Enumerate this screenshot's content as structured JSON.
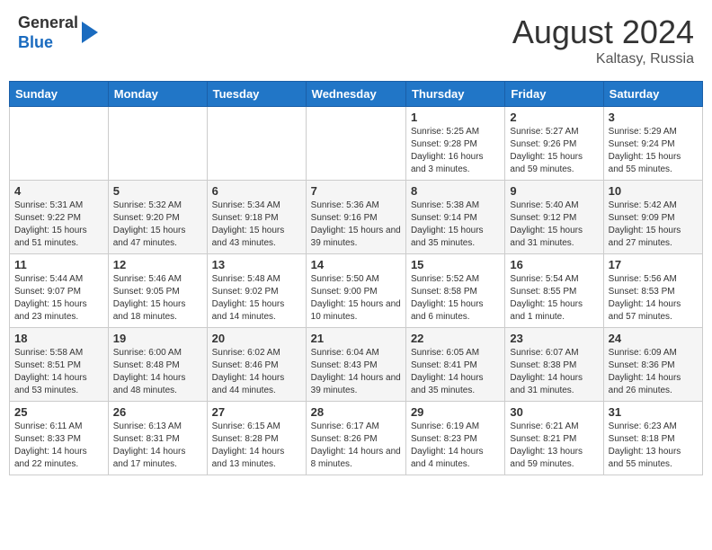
{
  "header": {
    "logo_line1": "General",
    "logo_line2": "Blue",
    "month_year": "August 2024",
    "location": "Kaltasy, Russia"
  },
  "days_of_week": [
    "Sunday",
    "Monday",
    "Tuesday",
    "Wednesday",
    "Thursday",
    "Friday",
    "Saturday"
  ],
  "weeks": [
    [
      {
        "day": "",
        "sunrise": "",
        "sunset": "",
        "daylight": ""
      },
      {
        "day": "",
        "sunrise": "",
        "sunset": "",
        "daylight": ""
      },
      {
        "day": "",
        "sunrise": "",
        "sunset": "",
        "daylight": ""
      },
      {
        "day": "",
        "sunrise": "",
        "sunset": "",
        "daylight": ""
      },
      {
        "day": "1",
        "sunrise": "Sunrise: 5:25 AM",
        "sunset": "Sunset: 9:28 PM",
        "daylight": "Daylight: 16 hours and 3 minutes."
      },
      {
        "day": "2",
        "sunrise": "Sunrise: 5:27 AM",
        "sunset": "Sunset: 9:26 PM",
        "daylight": "Daylight: 15 hours and 59 minutes."
      },
      {
        "day": "3",
        "sunrise": "Sunrise: 5:29 AM",
        "sunset": "Sunset: 9:24 PM",
        "daylight": "Daylight: 15 hours and 55 minutes."
      }
    ],
    [
      {
        "day": "4",
        "sunrise": "Sunrise: 5:31 AM",
        "sunset": "Sunset: 9:22 PM",
        "daylight": "Daylight: 15 hours and 51 minutes."
      },
      {
        "day": "5",
        "sunrise": "Sunrise: 5:32 AM",
        "sunset": "Sunset: 9:20 PM",
        "daylight": "Daylight: 15 hours and 47 minutes."
      },
      {
        "day": "6",
        "sunrise": "Sunrise: 5:34 AM",
        "sunset": "Sunset: 9:18 PM",
        "daylight": "Daylight: 15 hours and 43 minutes."
      },
      {
        "day": "7",
        "sunrise": "Sunrise: 5:36 AM",
        "sunset": "Sunset: 9:16 PM",
        "daylight": "Daylight: 15 hours and 39 minutes."
      },
      {
        "day": "8",
        "sunrise": "Sunrise: 5:38 AM",
        "sunset": "Sunset: 9:14 PM",
        "daylight": "Daylight: 15 hours and 35 minutes."
      },
      {
        "day": "9",
        "sunrise": "Sunrise: 5:40 AM",
        "sunset": "Sunset: 9:12 PM",
        "daylight": "Daylight: 15 hours and 31 minutes."
      },
      {
        "day": "10",
        "sunrise": "Sunrise: 5:42 AM",
        "sunset": "Sunset: 9:09 PM",
        "daylight": "Daylight: 15 hours and 27 minutes."
      }
    ],
    [
      {
        "day": "11",
        "sunrise": "Sunrise: 5:44 AM",
        "sunset": "Sunset: 9:07 PM",
        "daylight": "Daylight: 15 hours and 23 minutes."
      },
      {
        "day": "12",
        "sunrise": "Sunrise: 5:46 AM",
        "sunset": "Sunset: 9:05 PM",
        "daylight": "Daylight: 15 hours and 18 minutes."
      },
      {
        "day": "13",
        "sunrise": "Sunrise: 5:48 AM",
        "sunset": "Sunset: 9:02 PM",
        "daylight": "Daylight: 15 hours and 14 minutes."
      },
      {
        "day": "14",
        "sunrise": "Sunrise: 5:50 AM",
        "sunset": "Sunset: 9:00 PM",
        "daylight": "Daylight: 15 hours and 10 minutes."
      },
      {
        "day": "15",
        "sunrise": "Sunrise: 5:52 AM",
        "sunset": "Sunset: 8:58 PM",
        "daylight": "Daylight: 15 hours and 6 minutes."
      },
      {
        "day": "16",
        "sunrise": "Sunrise: 5:54 AM",
        "sunset": "Sunset: 8:55 PM",
        "daylight": "Daylight: 15 hours and 1 minute."
      },
      {
        "day": "17",
        "sunrise": "Sunrise: 5:56 AM",
        "sunset": "Sunset: 8:53 PM",
        "daylight": "Daylight: 14 hours and 57 minutes."
      }
    ],
    [
      {
        "day": "18",
        "sunrise": "Sunrise: 5:58 AM",
        "sunset": "Sunset: 8:51 PM",
        "daylight": "Daylight: 14 hours and 53 minutes."
      },
      {
        "day": "19",
        "sunrise": "Sunrise: 6:00 AM",
        "sunset": "Sunset: 8:48 PM",
        "daylight": "Daylight: 14 hours and 48 minutes."
      },
      {
        "day": "20",
        "sunrise": "Sunrise: 6:02 AM",
        "sunset": "Sunset: 8:46 PM",
        "daylight": "Daylight: 14 hours and 44 minutes."
      },
      {
        "day": "21",
        "sunrise": "Sunrise: 6:04 AM",
        "sunset": "Sunset: 8:43 PM",
        "daylight": "Daylight: 14 hours and 39 minutes."
      },
      {
        "day": "22",
        "sunrise": "Sunrise: 6:05 AM",
        "sunset": "Sunset: 8:41 PM",
        "daylight": "Daylight: 14 hours and 35 minutes."
      },
      {
        "day": "23",
        "sunrise": "Sunrise: 6:07 AM",
        "sunset": "Sunset: 8:38 PM",
        "daylight": "Daylight: 14 hours and 31 minutes."
      },
      {
        "day": "24",
        "sunrise": "Sunrise: 6:09 AM",
        "sunset": "Sunset: 8:36 PM",
        "daylight": "Daylight: 14 hours and 26 minutes."
      }
    ],
    [
      {
        "day": "25",
        "sunrise": "Sunrise: 6:11 AM",
        "sunset": "Sunset: 8:33 PM",
        "daylight": "Daylight: 14 hours and 22 minutes."
      },
      {
        "day": "26",
        "sunrise": "Sunrise: 6:13 AM",
        "sunset": "Sunset: 8:31 PM",
        "daylight": "Daylight: 14 hours and 17 minutes."
      },
      {
        "day": "27",
        "sunrise": "Sunrise: 6:15 AM",
        "sunset": "Sunset: 8:28 PM",
        "daylight": "Daylight: 14 hours and 13 minutes."
      },
      {
        "day": "28",
        "sunrise": "Sunrise: 6:17 AM",
        "sunset": "Sunset: 8:26 PM",
        "daylight": "Daylight: 14 hours and 8 minutes."
      },
      {
        "day": "29",
        "sunrise": "Sunrise: 6:19 AM",
        "sunset": "Sunset: 8:23 PM",
        "daylight": "Daylight: 14 hours and 4 minutes."
      },
      {
        "day": "30",
        "sunrise": "Sunrise: 6:21 AM",
        "sunset": "Sunset: 8:21 PM",
        "daylight": "Daylight: 13 hours and 59 minutes."
      },
      {
        "day": "31",
        "sunrise": "Sunrise: 6:23 AM",
        "sunset": "Sunset: 8:18 PM",
        "daylight": "Daylight: 13 hours and 55 minutes."
      }
    ]
  ]
}
